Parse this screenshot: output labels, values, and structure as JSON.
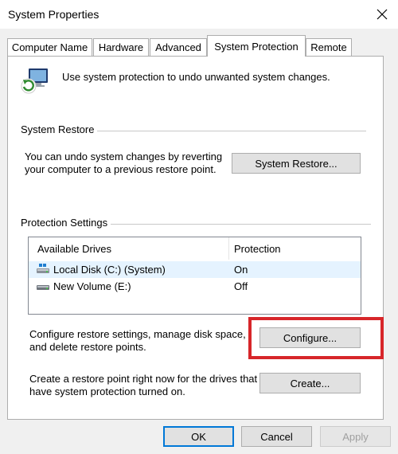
{
  "window": {
    "title": "System Properties",
    "close_icon": "close-icon"
  },
  "tabs": [
    {
      "label": "Computer Name",
      "active": false
    },
    {
      "label": "Hardware",
      "active": false
    },
    {
      "label": "Advanced",
      "active": false
    },
    {
      "label": "System Protection",
      "active": true
    },
    {
      "label": "Remote",
      "active": false
    }
  ],
  "intro": {
    "icon": "system-protection-icon",
    "text": "Use system protection to undo unwanted system changes."
  },
  "system_restore": {
    "group_label": "System Restore",
    "description_line1": "You can undo system changes by reverting",
    "description_line2": "your computer to a previous restore point.",
    "button_label": "System Restore..."
  },
  "protection_settings": {
    "group_label": "Protection Settings",
    "columns": [
      "Available Drives",
      "Protection"
    ],
    "drives": [
      {
        "icon": "system-drive-icon",
        "name": "Local Disk (C:) (System)",
        "protection": "On",
        "selected": true
      },
      {
        "icon": "drive-icon",
        "name": "New Volume (E:)",
        "protection": "Off",
        "selected": false
      }
    ],
    "configure_text_line1": "Configure restore settings, manage disk space,",
    "configure_text_line2": "and delete restore points.",
    "configure_button": "Configure...",
    "create_text_line1": "Create a restore point right now for the drives that",
    "create_text_line2": "have system protection turned on.",
    "create_button": "Create..."
  },
  "footer": {
    "ok": "OK",
    "cancel": "Cancel",
    "apply": "Apply"
  },
  "colors": {
    "highlight": "#d7262a",
    "default_button_border": "#0078d7"
  }
}
